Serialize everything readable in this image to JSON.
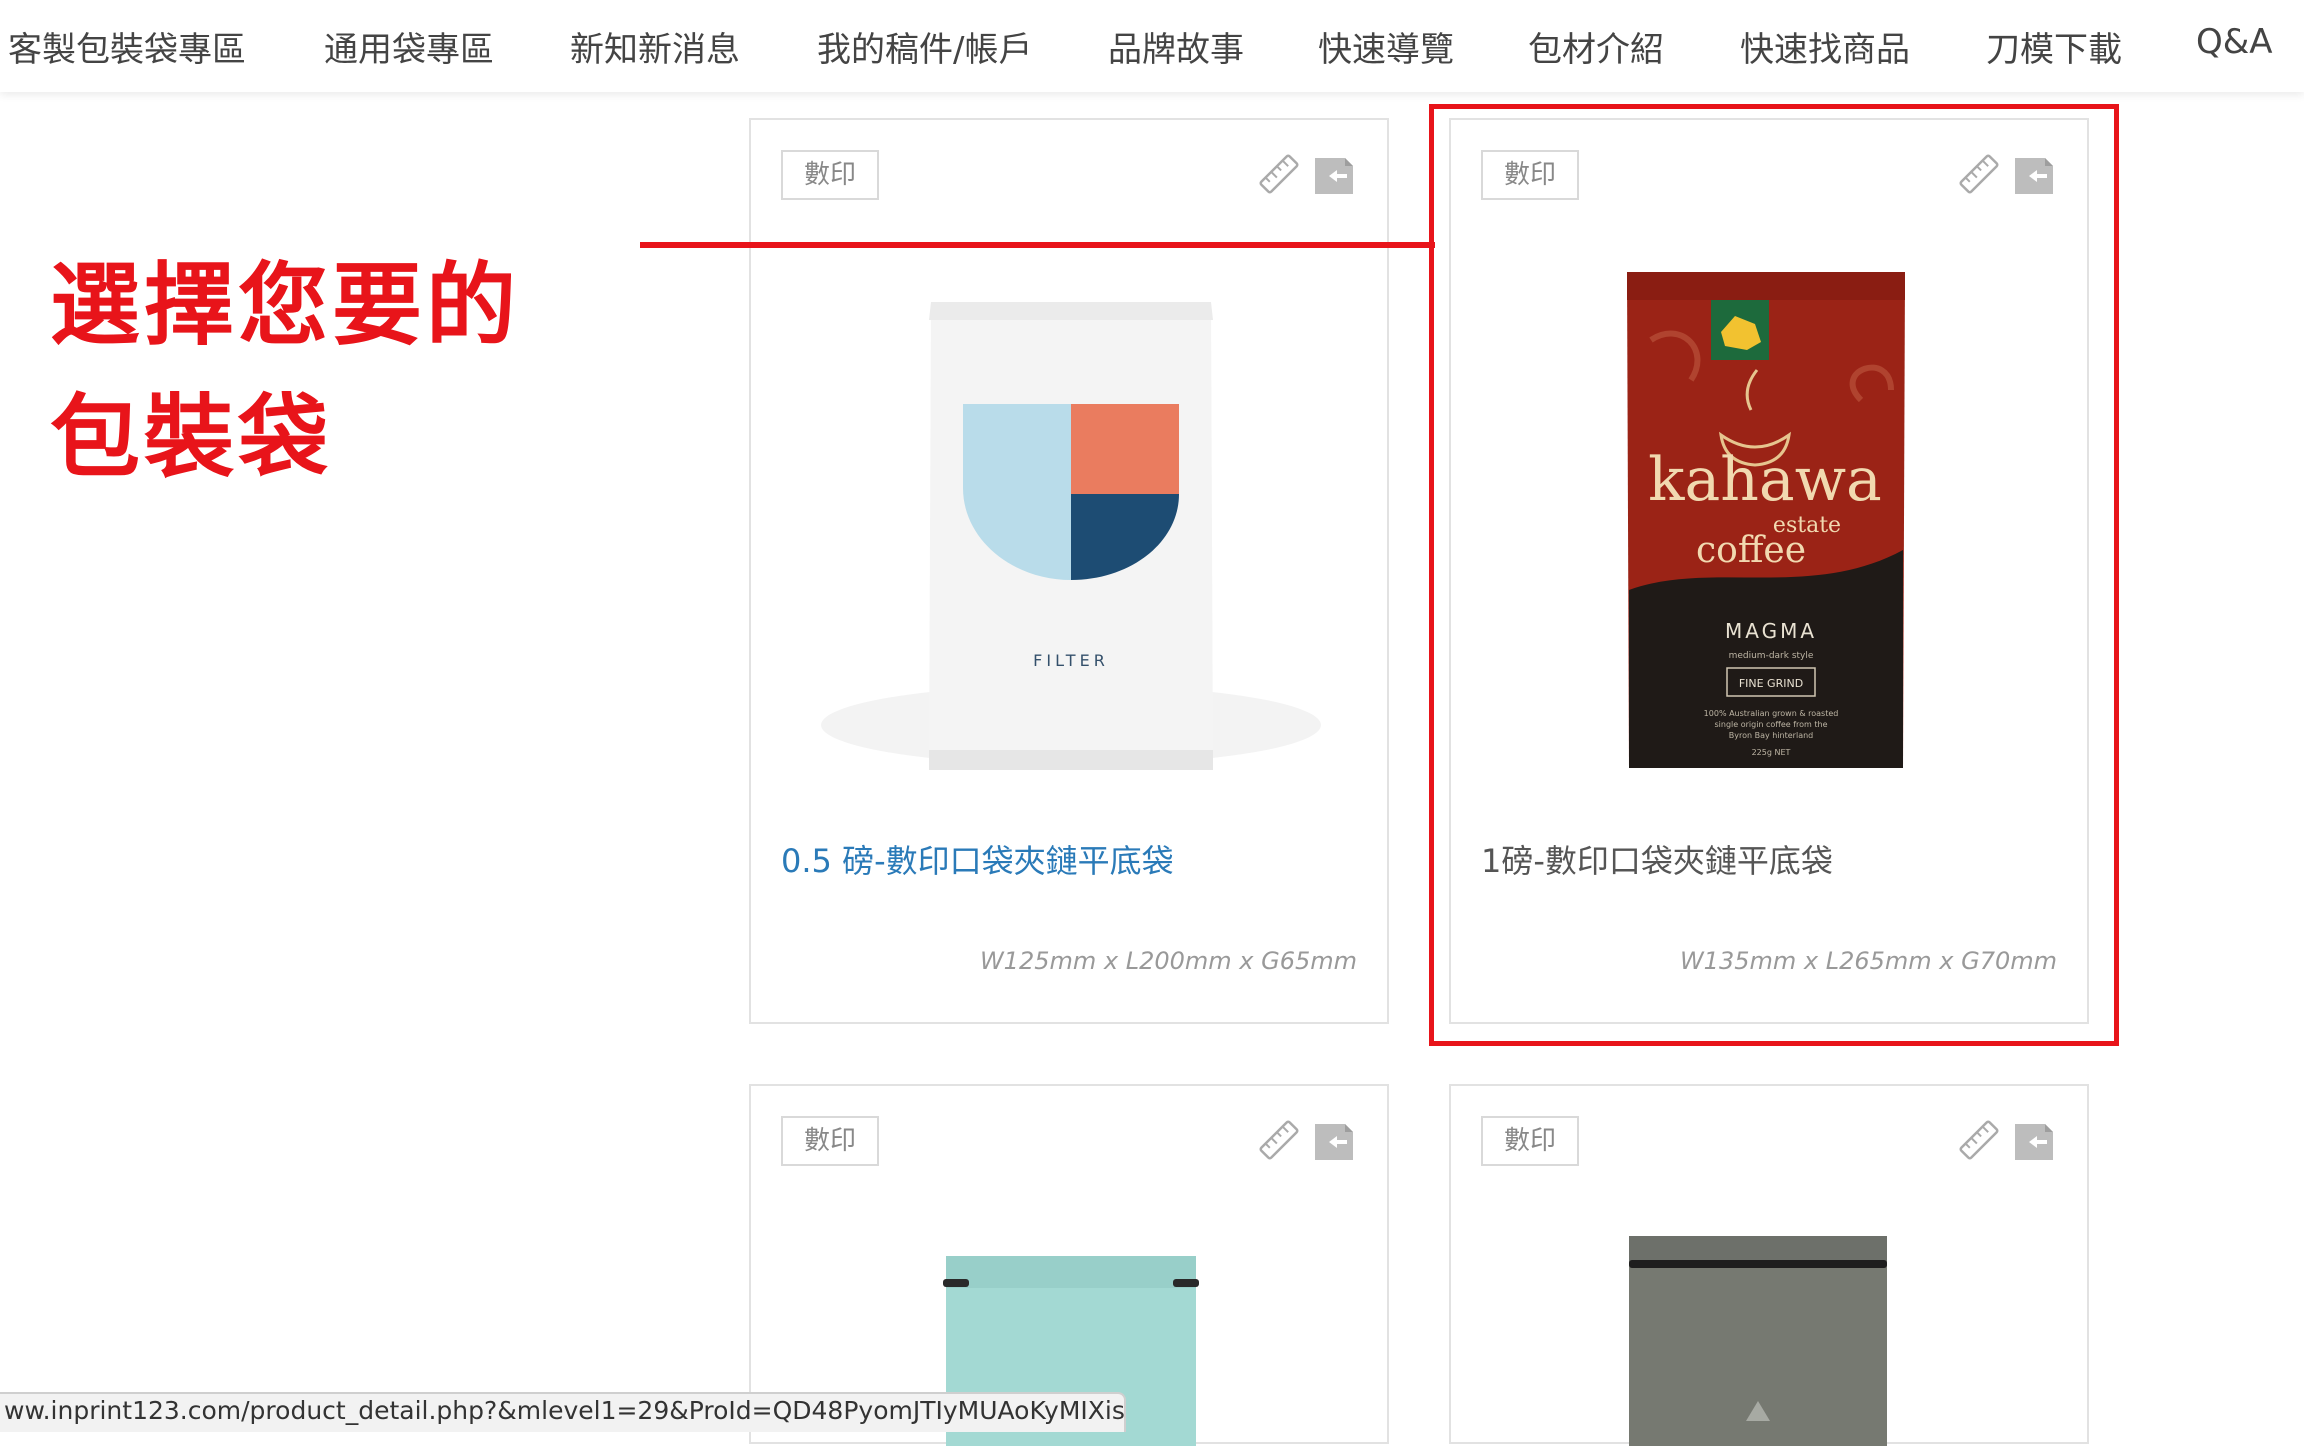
{
  "nav": {
    "items": [
      "客製包裝袋專區",
      "通用袋專區",
      "新知新消息",
      "我的稿件/帳戶",
      "品牌故事",
      "快速導覽",
      "包材介紹",
      "快速找商品",
      "刀模下載",
      "Q&A"
    ]
  },
  "annotation": {
    "line1": "選擇您要的",
    "line2": "包裝袋"
  },
  "products": [
    {
      "tag": "數印",
      "title": "0.5 磅-數印口袋夾鏈平底袋",
      "size": "W125mm x L200mm x G65mm",
      "bag_label": "FILTER"
    },
    {
      "tag": "數印",
      "title": "1磅-數印口袋夾鏈平底袋",
      "size": "W135mm x L265mm x G70mm",
      "bag_brand": "kahawa",
      "bag_sub1": "estate",
      "bag_sub2": "coffee",
      "bag_variant": "MAGMA",
      "bag_style": "medium-dark style",
      "bag_grind": "FINE GRIND",
      "bag_note1": "100% Australian grown & roasted",
      "bag_note2": "single origin coffee from the",
      "bag_note3": "Byron Bay hinterland",
      "bag_weight": "225g NET"
    },
    {
      "tag": "數印"
    },
    {
      "tag": "數印"
    }
  ],
  "statusbar": {
    "url": "ww.inprint123.com/product_detail.php?&mlevel1=29&ProId=QD48PyomJTIyMUAoKyMIXis="
  },
  "colors": {
    "annotation": "#e8141a",
    "link": "#2a7ab8",
    "bag_white": "#f4f4f4",
    "bag_red": "#9b2316",
    "bag_teal": "#a3d9d3",
    "bag_gray": "#767971"
  }
}
